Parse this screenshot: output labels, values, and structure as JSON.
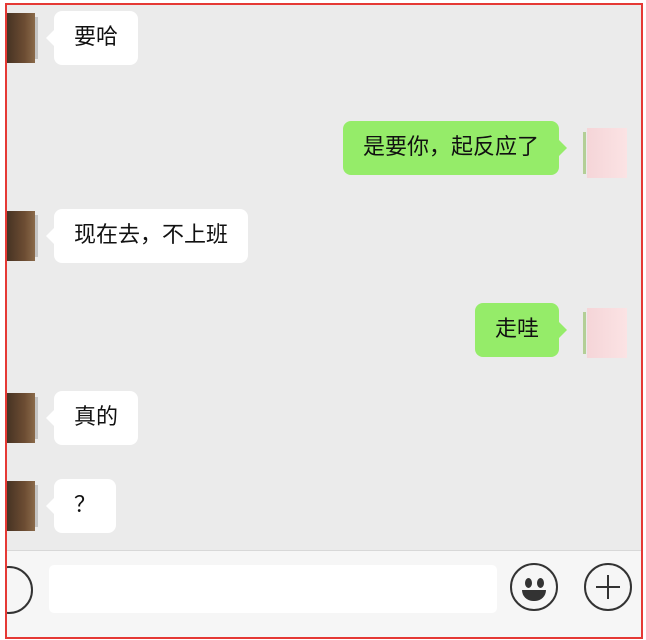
{
  "chat": {
    "messages": [
      {
        "side": "incoming",
        "text": "要哈"
      },
      {
        "side": "outgoing",
        "text": "是要你，起反应了"
      },
      {
        "side": "incoming",
        "text": "现在去，不上班"
      },
      {
        "side": "outgoing",
        "text": "走哇"
      },
      {
        "side": "incoming",
        "text": "真的"
      },
      {
        "side": "incoming",
        "text": "？"
      }
    ]
  },
  "input_bar": {
    "text_value": "",
    "icons": [
      "voice-icon",
      "emoji-icon",
      "plus-icon"
    ]
  },
  "colors": {
    "background": "#ebebeb",
    "incoming_bubble": "#ffffff",
    "outgoing_bubble": "#95ec69",
    "frame_border": "#e53935"
  }
}
